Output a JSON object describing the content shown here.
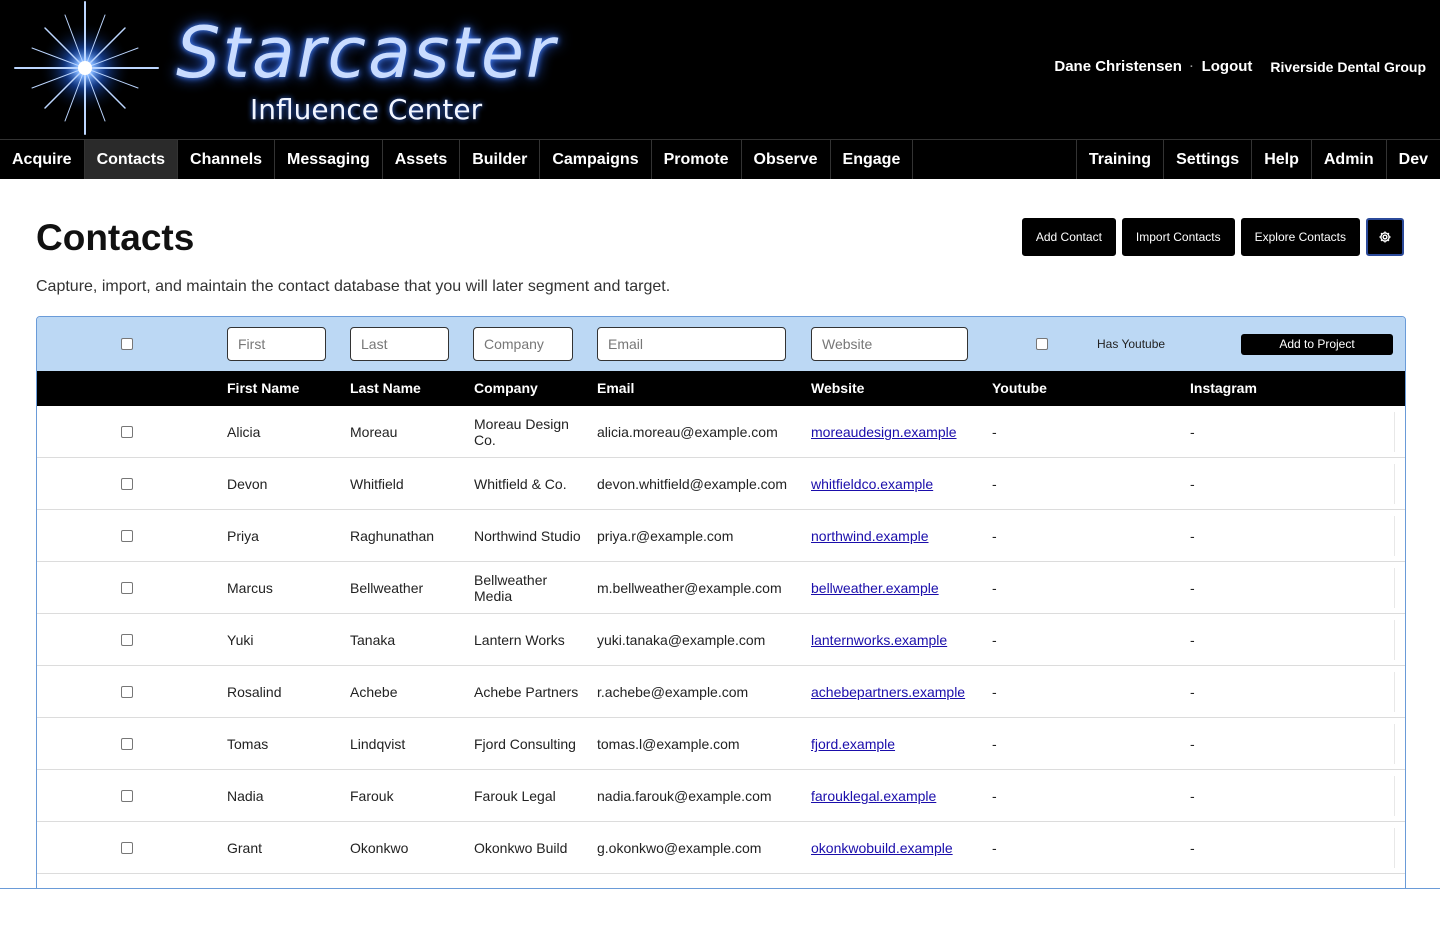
{
  "app": {
    "logo_title": "Starcaster",
    "logo_subtitle": "Influence Center",
    "user_name": "Dane Christensen",
    "separator": "·",
    "logout_label": "Logout",
    "org_name": "Riverside Dental Group"
  },
  "nav": {
    "left": [
      "Acquire",
      "Contacts",
      "Channels",
      "Messaging",
      "Assets",
      "Builder",
      "Campaigns",
      "Promote",
      "Observe",
      "Engage"
    ],
    "right": [
      "Training",
      "Settings",
      "Help",
      "Admin",
      "Dev"
    ],
    "active": "Contacts"
  },
  "page": {
    "title": "Contacts",
    "description": "Capture, import, and maintain the contact database that you will later segment and target.",
    "buttons": {
      "add": "Add Contact",
      "import": "Import Contacts",
      "explore": "Explore Contacts",
      "settings_icon": "gear-icon"
    }
  },
  "filters": {
    "first_placeholder": "First",
    "last_placeholder": "Last",
    "company_placeholder": "Company",
    "email_placeholder": "Email",
    "website_placeholder": "Website",
    "has_youtube_label": "Has Youtube",
    "add_to_project_label": "Add to Project"
  },
  "table": {
    "columns": [
      "First Name",
      "Last Name",
      "Company",
      "Email",
      "Website",
      "Youtube",
      "Instagram"
    ],
    "rows": [
      {
        "first": "Alicia",
        "last": "Moreau",
        "company": "Moreau Design Co.",
        "email": "alicia.moreau@example.com",
        "website": "moreaudesign.example",
        "youtube": "-",
        "instagram": "-"
      },
      {
        "first": "Devon",
        "last": "Whitfield",
        "company": "Whitfield & Co.",
        "email": "devon.whitfield@example.com",
        "website": "whitfieldco.example",
        "youtube": "-",
        "instagram": "-"
      },
      {
        "first": "Priya",
        "last": "Raghunathan",
        "company": "Northwind Studio",
        "email": "priya.r@example.com",
        "website": "northwind.example",
        "youtube": "-",
        "instagram": "-"
      },
      {
        "first": "Marcus",
        "last": "Bellweather",
        "company": "Bellweather Media",
        "email": "m.bellweather@example.com",
        "website": "bellweather.example",
        "youtube": "-",
        "instagram": "-"
      },
      {
        "first": "Yuki",
        "last": "Tanaka",
        "company": "Lantern Works",
        "email": "yuki.tanaka@example.com",
        "website": "lanternworks.example",
        "youtube": "-",
        "instagram": "-"
      },
      {
        "first": "Rosalind",
        "last": "Achebe",
        "company": "Achebe Partners",
        "email": "r.achebe@example.com",
        "website": "achebepartners.example",
        "youtube": "-",
        "instagram": "-"
      },
      {
        "first": "Tomas",
        "last": "Lindqvist",
        "company": "Fjord Consulting",
        "email": "tomas.l@example.com",
        "website": "fjord.example",
        "youtube": "-",
        "instagram": "-"
      },
      {
        "first": "Nadia",
        "last": "Farouk",
        "company": "Farouk Legal",
        "email": "nadia.farouk@example.com",
        "website": "farouklegal.example",
        "youtube": "-",
        "instagram": "-"
      },
      {
        "first": "Grant",
        "last": "Okonkwo",
        "company": "Okonkwo Build",
        "email": "g.okonkwo@example.com",
        "website": "okonkwobuild.example",
        "youtube": "-",
        "instagram": "-"
      }
    ]
  }
}
